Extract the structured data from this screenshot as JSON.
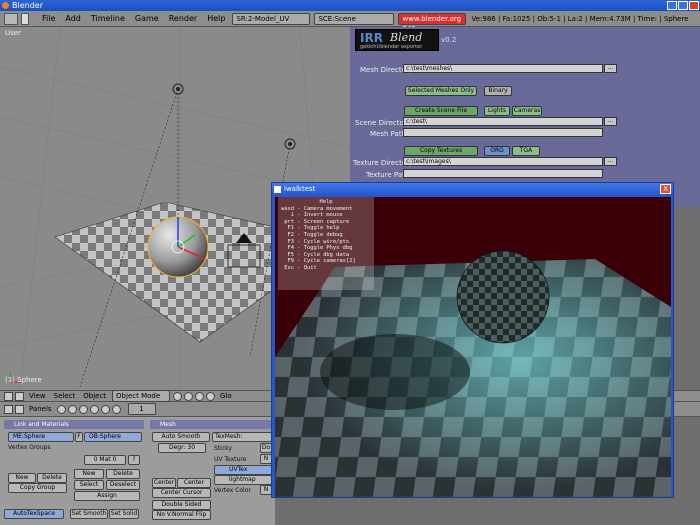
{
  "window": {
    "title": "Blender"
  },
  "menubar": {
    "items": [
      "File",
      "Add",
      "Timeline",
      "Game",
      "Render",
      "Help"
    ],
    "screen_field": "SR:2-Model_UV",
    "scene_field": "SCE:Scene",
    "url": "www.blender.org 245",
    "stats": "Ve:986 | Fa:1025 | Ob:5-1 | La:2 | Mem:4.73M | Time: | Sphere"
  },
  "viewport": {
    "view_label": "User",
    "object_label": "(1) Sphere"
  },
  "exporter": {
    "logo_main": "IRR",
    "logo_blend": "Blend",
    "logo_sub": "gekkiht/blender exporter",
    "version": "v0.2",
    "mesh_dir_label": "Mesh Directory",
    "mesh_dir_value": "c:\\test\\meshes\\",
    "selected_meshes_only": "Selected Meshes Only",
    "binary": "Binary",
    "create_scene_file": "Create Scene File",
    "lights": "Lights",
    "cameras": "Cameras",
    "scene_dir_label": "Scene Directory",
    "scene_dir_value": "c:\\test\\",
    "mesh_path_label": "Mesh Path",
    "copy_textures": "Copy Textures",
    "org": "ORG",
    "tga": "TGA",
    "texture_dir_label": "Texture Directory",
    "texture_dir_value": "c:\\test\\images\\",
    "texture_path_label": "Texture Path",
    "browse": "..."
  },
  "viewheader": {
    "view": "View",
    "select": "Select",
    "object": "Object",
    "mode": "Object Mode",
    "glo": "Glo"
  },
  "buttons": {
    "panels": "Panels",
    "frame": "1",
    "link_materials_title": "Link and Materials",
    "mesh_title": "Mesh",
    "me_field": "ME:Sphere",
    "ob_field": "OB:Sphere",
    "f_label": "F",
    "vertex_groups": "Vertex Groups",
    "mat_counter": "0 Mat 0",
    "question": "?",
    "new": "New",
    "delete": "Delete",
    "copy_group": "Copy Group",
    "new2": "New",
    "delete2": "Delete",
    "select": "Select",
    "deselect": "Deselect",
    "assign": "Assign",
    "auto_smooth": "Auto Smooth",
    "degr": "Degr: 30",
    "center": "Center",
    "center_new": "Center New",
    "center_cursor": "Center Cursor",
    "double_sided": "Double Sided",
    "no_v_normal_flip": "No V.Normal Flip",
    "tex_mesh": "TexMesh:",
    "sticky": "Sticky",
    "uv_texture": "UV Texture",
    "uvtex": "UVTex",
    "lightmap": "lightmap",
    "vertex_color": "Vertex Color",
    "auto_tex_space": "AutoTexSpace",
    "set_smooth": "Set Smooth",
    "set_solid": "Set Solid",
    "do": "Do",
    "n": "N"
  },
  "render_window": {
    "title": "iwalktest",
    "close": "X",
    "help_title": "Help",
    "help_lines": [
      "wasd - Camera movement",
      "   i - Invert mouse",
      " prt - Screen capture",
      "  F1 - Toggle help",
      "  F2 - Toggle debug",
      "  F3 - Cycle wire/pts",
      "  F4 - Toggle Phys dbg",
      "  F5 - Cycle dbg data",
      "  F9 - Cycle cameras[2]",
      " Esc - Quit"
    ]
  },
  "colors": {
    "titlebar": "#2556cc",
    "script_bg": "#6a6a9a",
    "render_bg": "#3a0008",
    "url_field": "#d83030"
  }
}
